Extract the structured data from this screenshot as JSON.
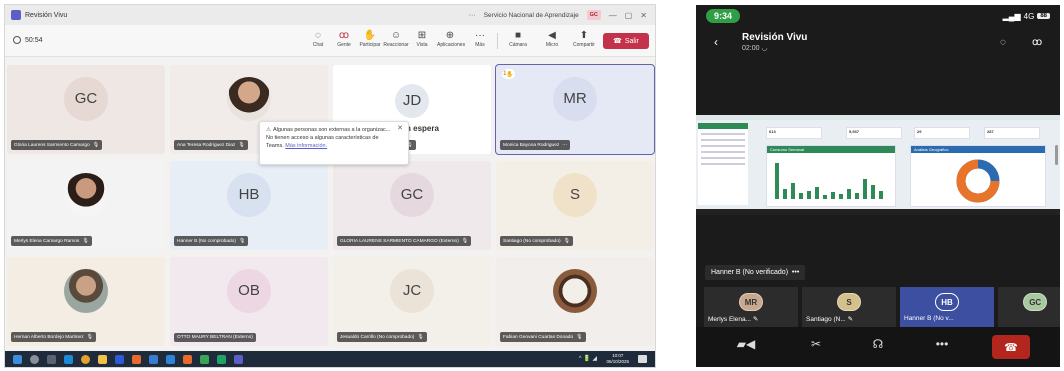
{
  "desktop": {
    "window_title": "Revisión Vivu",
    "org": "Servicio Nacional de Aprendizaje",
    "org_badge": "GC",
    "timer": "50:54",
    "toolbar": {
      "chat": "Chat",
      "people": "Gente",
      "raise": "Participar",
      "react": "Reaccionar",
      "view": "Vista",
      "apps": "Aplicaciones",
      "more": "Más",
      "camera": "Cámara",
      "mic": "Micro",
      "share": "Compartir",
      "leave": "Salir"
    },
    "toast": {
      "line1": "Algunas personas son externas a la organizac...",
      "line2": "No tienen acceso a algunas características de",
      "line3": "Teams.",
      "link": "Más información."
    },
    "tiles": [
      {
        "initials": "GC",
        "name": "Gloria Laurens Sarmiento Camargo",
        "bg": "#efe7e3"
      },
      {
        "initials": "",
        "name": "Ana Teresa Rodriguez Diaz",
        "bg": "#f1ece9"
      },
      {
        "initials": "JD",
        "name": "Javier Alfonso Ramirez Duran",
        "bg": "#ffffff",
        "hold": "En espera"
      },
      {
        "initials": "MR",
        "name": "Monica Bayona Rodriguez",
        "bg": "#e5e8f5",
        "badge": "1"
      },
      {
        "initials": "",
        "name": "Merlys Elena Camargo Ramos",
        "bg": "#f3f3f3"
      },
      {
        "initials": "HB",
        "name": "Hanner B (No comprobado)",
        "bg": "#e8eef6"
      },
      {
        "initials": "GC",
        "name": "GLORIA LAURENS SARMIENTO CAMARGO (Externo)",
        "bg": "#f0e9ec"
      },
      {
        "initials": "S",
        "name": "Santiago (No comprobado)",
        "bg": "#f4efe6"
      },
      {
        "initials": "",
        "name": "Hernan Alberto Bordejo Martinez",
        "bg": "#f3ede3"
      },
      {
        "initials": "OB",
        "name": "OTTO MAURY BELTRAN (Externo)",
        "bg": "#f1e9ee"
      },
      {
        "initials": "JC",
        "name": "Jesualdo Carrillo (No comprobado)",
        "bg": "#f3efe9"
      },
      {
        "initials": "",
        "name": "Fabian Geovani Cuartas Donado",
        "bg": "#f1eeeb"
      }
    ],
    "taskbar": {
      "time": "10:07",
      "date": "06/10/2025"
    }
  },
  "mobile": {
    "status_time": "9:34",
    "status_right": "4G",
    "battery": "88",
    "title": "Revisión Vivu",
    "duration": "02:00",
    "speaker_name": "Hanner B (No verificado)",
    "speaker_more": "•••",
    "share_cards": [
      "613",
      "5,937",
      "29",
      "287"
    ],
    "share_panel1": "Consumo Semanal",
    "share_panel2": "Análisis Geográfico",
    "tiles": [
      {
        "initials": "MR",
        "name": "Merlys Elena...",
        "color": "#c8a98f"
      },
      {
        "initials": "S",
        "name": "Santiago (N...",
        "color": "#d4c08a"
      },
      {
        "initials": "HB",
        "name": "Hanner B (No v...",
        "color": "#3c4fa0"
      },
      {
        "initials": "GC",
        "name": "",
        "color": "#a8c8a0"
      }
    ],
    "colors": {
      "green": "#2e8b57",
      "blue": "#2b6cb0",
      "leave": "#b3261e"
    }
  }
}
